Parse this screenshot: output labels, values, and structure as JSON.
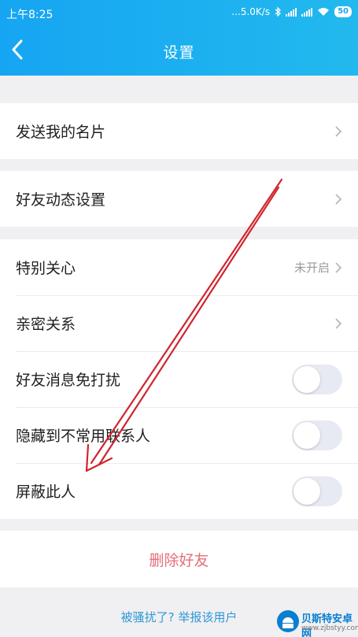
{
  "status_bar": {
    "time": "上午8:25",
    "network_speed": "5.0K/s",
    "battery": "50"
  },
  "header": {
    "title": "设置",
    "back_icon": "chevron-left-icon"
  },
  "sections": [
    {
      "rows": [
        {
          "label": "发送我的名片",
          "type": "nav"
        }
      ]
    },
    {
      "rows": [
        {
          "label": "好友动态设置",
          "type": "nav"
        }
      ]
    },
    {
      "rows": [
        {
          "label": "特别关心",
          "type": "nav",
          "value": "未开启"
        },
        {
          "label": "亲密关系",
          "type": "nav"
        },
        {
          "label": "好友消息免打扰",
          "type": "toggle",
          "on": false
        },
        {
          "label": "隐藏到不常用联系人",
          "type": "toggle",
          "on": false
        },
        {
          "label": "屏蔽此人",
          "type": "toggle",
          "on": false
        }
      ]
    }
  ],
  "actions": {
    "delete_friend": "删除好友",
    "report_link": "被骚扰了? 举报该用户"
  },
  "watermark": {
    "name": "贝斯特安卓网",
    "url": "www.zjbstyy.com"
  },
  "colors": {
    "header_start": "#16a5f2",
    "header_end": "#22b9ee",
    "delete_text": "#e36f7b",
    "link_text": "#2d98d6",
    "annotation_arrow": "#d0252f"
  }
}
